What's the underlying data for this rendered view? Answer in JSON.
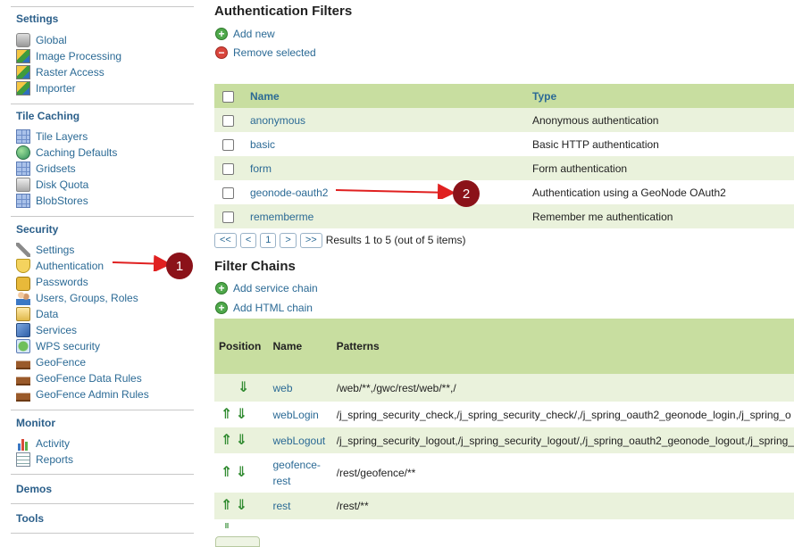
{
  "sidebar": {
    "sections": [
      {
        "title": "Settings",
        "items": [
          {
            "label": "Global",
            "icon": "database-icon"
          },
          {
            "label": "Image Processing",
            "icon": "image-icon"
          },
          {
            "label": "Raster Access",
            "icon": "raster-icon"
          },
          {
            "label": "Importer",
            "icon": "importer-icon"
          }
        ]
      },
      {
        "title": "Tile Caching",
        "items": [
          {
            "label": "Tile Layers",
            "icon": "grid-icon"
          },
          {
            "label": "Caching Defaults",
            "icon": "globe-icon"
          },
          {
            "label": "Gridsets",
            "icon": "grid-icon"
          },
          {
            "label": "Disk Quota",
            "icon": "disk-icon"
          },
          {
            "label": "BlobStores",
            "icon": "grid-icon"
          }
        ]
      },
      {
        "title": "Security",
        "items": [
          {
            "label": "Settings",
            "icon": "wrench-icon"
          },
          {
            "label": "Authentication",
            "icon": "shield-icon"
          },
          {
            "label": "Passwords",
            "icon": "lock-icon"
          },
          {
            "label": "Users, Groups, Roles",
            "icon": "users-icon"
          },
          {
            "label": "Data",
            "icon": "data-icon"
          },
          {
            "label": "Services",
            "icon": "services-icon"
          },
          {
            "label": "WPS security",
            "icon": "wps-icon"
          },
          {
            "label": "GeoFence",
            "icon": "geofence-icon"
          },
          {
            "label": "GeoFence Data Rules",
            "icon": "geofence-icon"
          },
          {
            "label": "GeoFence Admin Rules",
            "icon": "geofence-icon"
          }
        ]
      },
      {
        "title": "Monitor",
        "items": [
          {
            "label": "Activity",
            "icon": "activity-icon"
          },
          {
            "label": "Reports",
            "icon": "reports-icon"
          }
        ]
      },
      {
        "title": "Demos",
        "items": []
      },
      {
        "title": "Tools",
        "items": []
      }
    ]
  },
  "auth_filters": {
    "title": "Authentication Filters",
    "add_new": "Add new",
    "remove_selected": "Remove selected",
    "columns": {
      "name": "Name",
      "type": "Type"
    },
    "rows": [
      {
        "name": "anonymous",
        "type": "Anonymous authentication"
      },
      {
        "name": "basic",
        "type": "Basic HTTP authentication"
      },
      {
        "name": "form",
        "type": "Form authentication"
      },
      {
        "name": "geonode-oauth2",
        "type": "Authentication using a GeoNode OAuth2"
      },
      {
        "name": "rememberme",
        "type": "Remember me authentication"
      }
    ],
    "pager": {
      "first": "<<",
      "prev": "<",
      "page": "1",
      "next": ">",
      "last": ">>",
      "info": "Results 1 to 5 (out of 5 items)"
    }
  },
  "filter_chains": {
    "title": "Filter Chains",
    "add_service_chain": "Add service chain",
    "add_html_chain": "Add HTML chain",
    "columns": {
      "position": "Position",
      "name": "Name",
      "patterns": "Patterns"
    },
    "rows": [
      {
        "name": "web",
        "patterns": "/web/**,/gwc/rest/web/**,/",
        "up": false,
        "down": true
      },
      {
        "name": "webLogin",
        "patterns": "/j_spring_security_check,/j_spring_security_check/,/j_spring_oauth2_geonode_login,/j_spring_o",
        "up": true,
        "down": true
      },
      {
        "name": "webLogout",
        "patterns": "/j_spring_security_logout,/j_spring_security_logout/,/j_spring_oauth2_geonode_logout,/j_spring_",
        "up": true,
        "down": true
      },
      {
        "name": "geofence-rest",
        "patterns": "/rest/geofence/**",
        "up": true,
        "down": true
      },
      {
        "name": "rest",
        "patterns": "/rest/**",
        "up": true,
        "down": true
      }
    ]
  },
  "callouts": {
    "one": "1",
    "two": "2"
  },
  "colors": {
    "header_green": "#c8dea0",
    "row_green": "#eaf2dc",
    "link_blue": "#2b6a95",
    "badge_red": "#8b1219",
    "arrow_red": "#e02020"
  }
}
